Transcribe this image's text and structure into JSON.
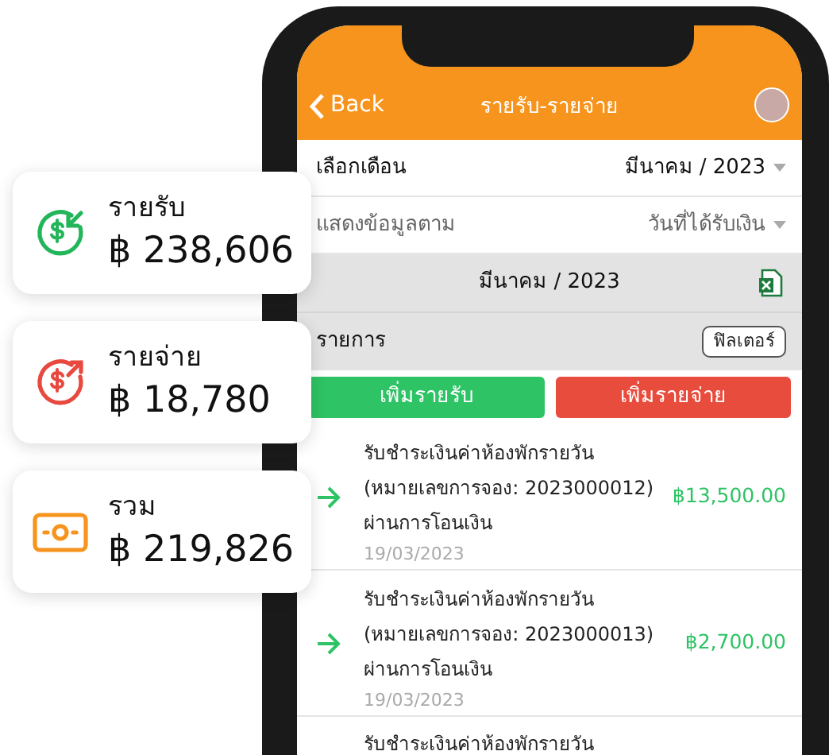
{
  "header": {
    "back": "Back",
    "title": "รายรับ-รายจ่าย"
  },
  "filters": [
    {
      "label": "เลือกเดือน",
      "value": "มีนาคม / 2023",
      "bold": true
    },
    {
      "label": "แสดงข้อมูลตาม",
      "value": "วันที่ได้รับเงิน",
      "bold": false
    }
  ],
  "period": "มีนาคม / 2023",
  "list_header": {
    "title": "รายการ",
    "filter_button": "ฟิลเตอร์"
  },
  "actions": [
    {
      "label": "เพิ่มรายรับ",
      "kind": "income"
    },
    {
      "label": "เพิ่มรายจ่าย",
      "kind": "expense"
    }
  ],
  "transactions": [
    {
      "kind": "income",
      "title": "รับชำระเงินค่าห้องพักรายวัน",
      "ref": "(หมายเลขการจอง: 2023000012)",
      "method": "ผ่านการโอนเงิน",
      "date": "19/03/2023",
      "amount": "฿13,500.00"
    },
    {
      "kind": "income",
      "title": "รับชำระเงินค่าห้องพักรายวัน",
      "ref": "(หมายเลขการจอง: 2023000013)",
      "method": "ผ่านการโอนเงิน",
      "date": "19/03/2023",
      "amount": "฿2,700.00"
    },
    {
      "title": "รับชำระเงินค่าห้องพักรายวัน"
    }
  ],
  "summary": [
    {
      "kind": "income",
      "label": "รายรับ",
      "amount": "฿ 238,606"
    },
    {
      "kind": "expense",
      "label": "รายจ่าย",
      "amount": "฿ 18,780"
    },
    {
      "kind": "total",
      "label": "รวม",
      "amount": "฿ 219,826"
    }
  ]
}
